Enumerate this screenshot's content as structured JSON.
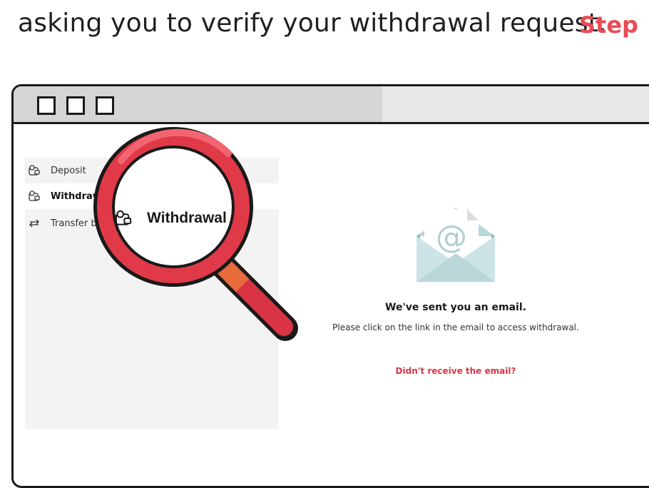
{
  "header": {
    "instruction": "asking you to verify your withdrawal request.",
    "step_label": "Step"
  },
  "sidebar": {
    "items": [
      {
        "label": "Deposit",
        "icon": "wallet-deposit-icon"
      },
      {
        "label": "Withdrawal",
        "icon": "wallet-withdrawal-icon",
        "active": true
      },
      {
        "label": "Transfer b",
        "icon": "transfer-arrows-icon"
      }
    ]
  },
  "main": {
    "title": "We've sent you an email.",
    "description": "Please click on the link in the email to access withdrawal.",
    "resend_link": "Didn't receive the email?"
  },
  "magnifier": {
    "label": "Withdrawal"
  },
  "colors": {
    "accent": "#e94b57",
    "link": "#d93648",
    "lens_rim": "#e03a48",
    "envelope": "#cde4e6"
  }
}
